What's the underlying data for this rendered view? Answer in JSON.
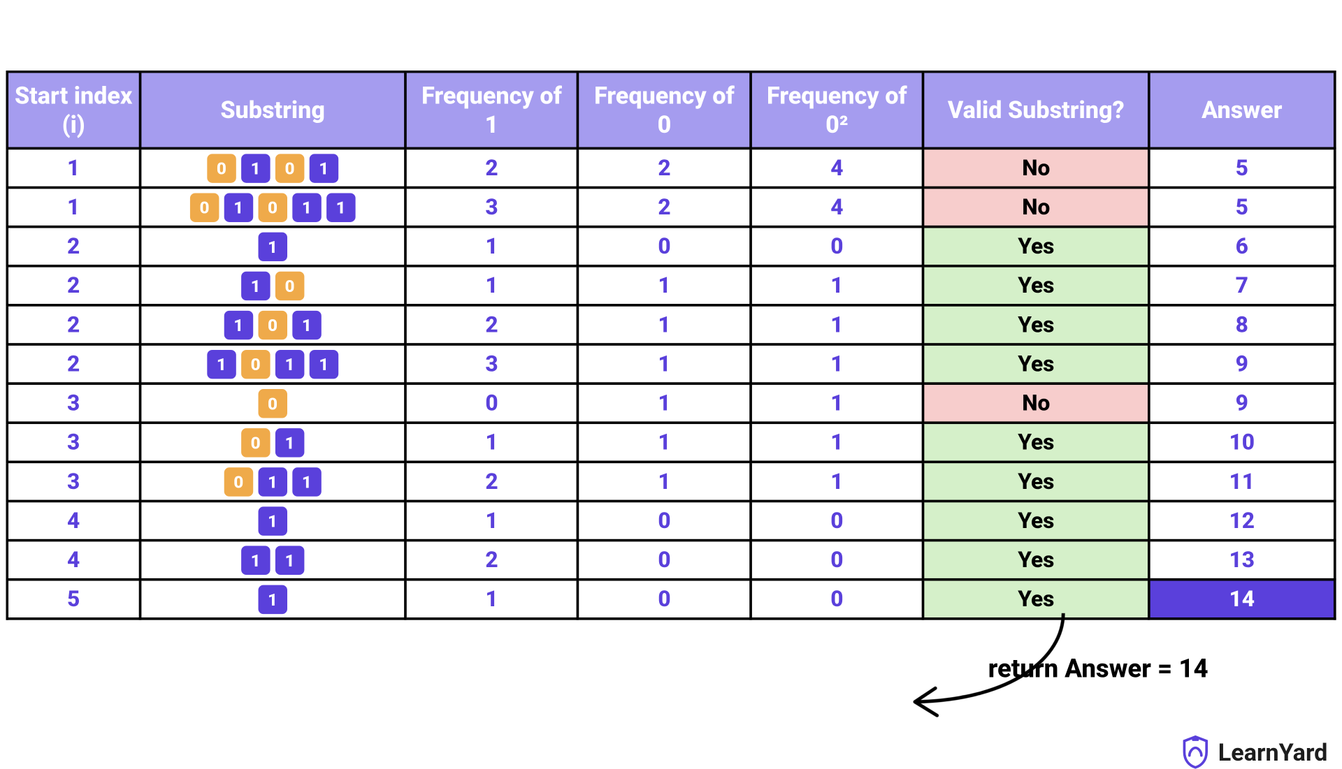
{
  "headers": {
    "idx": "Start index (i)",
    "sub": "Substring",
    "f1": "Frequency of 1",
    "f0": "Frequency of 0",
    "f0sq": "Frequency of 0²",
    "valid": "Valid Substring?",
    "ans": "Answer"
  },
  "rows": [
    {
      "i": "1",
      "bits": [
        "0",
        "1",
        "0",
        "1"
      ],
      "f1": "2",
      "f0": "2",
      "f0sq": "4",
      "valid": "No",
      "ans": "5"
    },
    {
      "i": "1",
      "bits": [
        "0",
        "1",
        "0",
        "1",
        "1"
      ],
      "f1": "3",
      "f0": "2",
      "f0sq": "4",
      "valid": "No",
      "ans": "5"
    },
    {
      "i": "2",
      "bits": [
        "1"
      ],
      "f1": "1",
      "f0": "0",
      "f0sq": "0",
      "valid": "Yes",
      "ans": "6"
    },
    {
      "i": "2",
      "bits": [
        "1",
        "0"
      ],
      "f1": "1",
      "f0": "1",
      "f0sq": "1",
      "valid": "Yes",
      "ans": "7"
    },
    {
      "i": "2",
      "bits": [
        "1",
        "0",
        "1"
      ],
      "f1": "2",
      "f0": "1",
      "f0sq": "1",
      "valid": "Yes",
      "ans": "8"
    },
    {
      "i": "2",
      "bits": [
        "1",
        "0",
        "1",
        "1"
      ],
      "f1": "3",
      "f0": "1",
      "f0sq": "1",
      "valid": "Yes",
      "ans": "9"
    },
    {
      "i": "3",
      "bits": [
        "0"
      ],
      "f1": "0",
      "f0": "1",
      "f0sq": "1",
      "valid": "No",
      "ans": "9"
    },
    {
      "i": "3",
      "bits": [
        "0",
        "1"
      ],
      "f1": "1",
      "f0": "1",
      "f0sq": "1",
      "valid": "Yes",
      "ans": "10"
    },
    {
      "i": "3",
      "bits": [
        "0",
        "1",
        "1"
      ],
      "f1": "2",
      "f0": "1",
      "f0sq": "1",
      "valid": "Yes",
      "ans": "11"
    },
    {
      "i": "4",
      "bits": [
        "1"
      ],
      "f1": "1",
      "f0": "0",
      "f0sq": "0",
      "valid": "Yes",
      "ans": "12"
    },
    {
      "i": "4",
      "bits": [
        "1",
        "1"
      ],
      "f1": "2",
      "f0": "0",
      "f0sq": "0",
      "valid": "Yes",
      "ans": "13"
    },
    {
      "i": "5",
      "bits": [
        "1"
      ],
      "f1": "1",
      "f0": "0",
      "f0sq": "0",
      "valid": "Yes",
      "ans": "14",
      "final": true
    }
  ],
  "return_text": "return Answer = 14",
  "brand": "LearnYard"
}
